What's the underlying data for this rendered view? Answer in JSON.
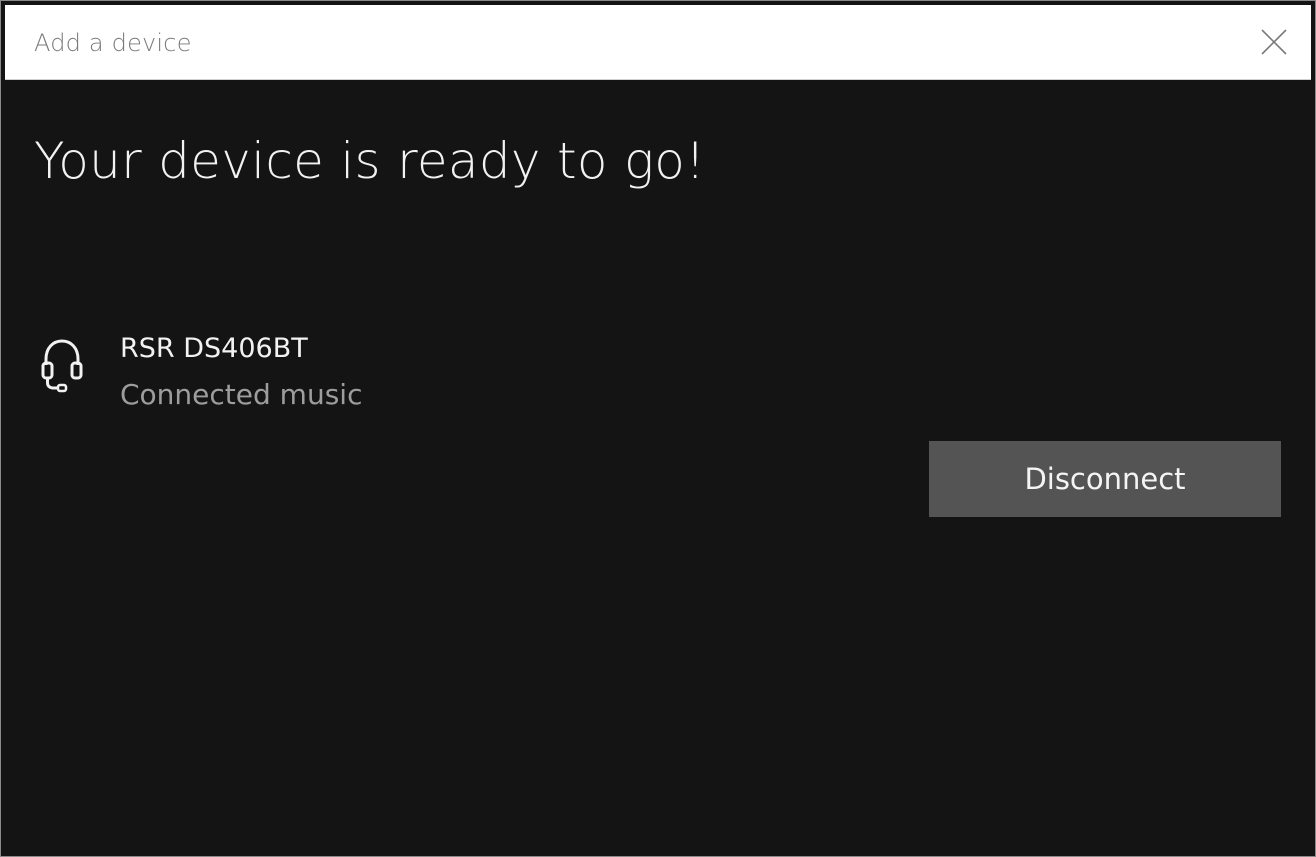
{
  "window": {
    "title": "Add a device",
    "close_icon": "close-icon"
  },
  "main": {
    "headline": "Your device is ready to go!",
    "device": {
      "icon": "headset-icon",
      "name": "RSR DS406BT",
      "status": "Connected music"
    },
    "disconnect_label": "Disconnect"
  },
  "colors": {
    "background": "#141414",
    "titlebar": "#ffffff",
    "button": "#545454",
    "primary_text": "#f2f2f2",
    "secondary_text": "#9d9d9d"
  }
}
